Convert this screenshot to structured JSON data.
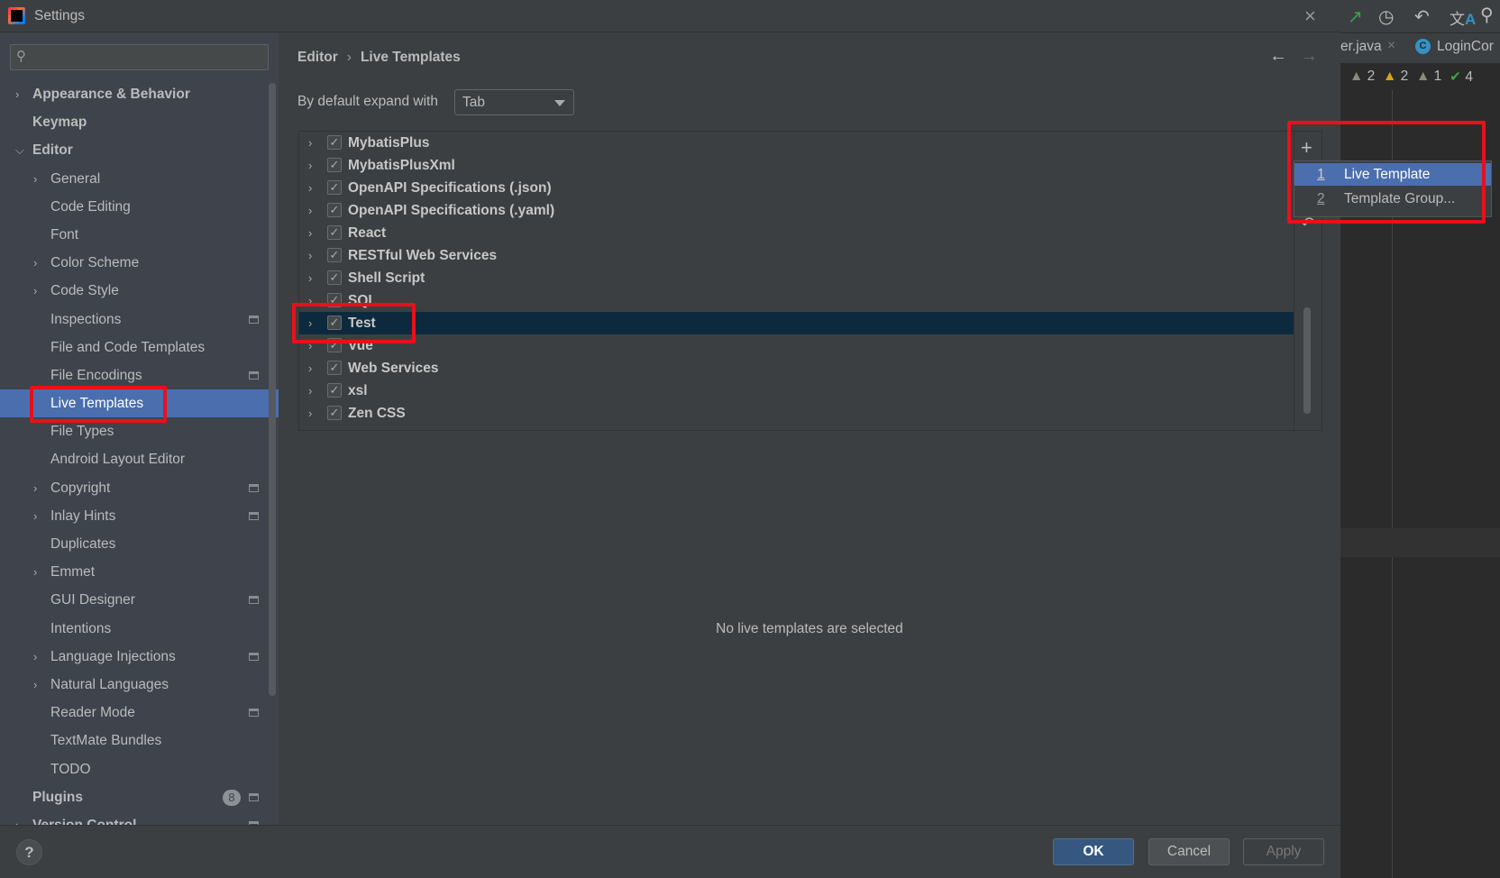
{
  "window": {
    "title": "Settings",
    "close": "×"
  },
  "search": {
    "placeholder": "",
    "icon": "search-icon"
  },
  "sidebar": {
    "items": [
      {
        "label": "Appearance & Behavior",
        "level": 0,
        "arrow": "right",
        "bold": true
      },
      {
        "label": "Keymap",
        "level": 0,
        "bold": true
      },
      {
        "label": "Editor",
        "level": 0,
        "arrow": "down",
        "bold": true
      },
      {
        "label": "General",
        "level": 1,
        "arrow": "right"
      },
      {
        "label": "Code Editing",
        "level": 1
      },
      {
        "label": "Font",
        "level": 1
      },
      {
        "label": "Color Scheme",
        "level": 1,
        "arrow": "right"
      },
      {
        "label": "Code Style",
        "level": 1,
        "arrow": "right"
      },
      {
        "label": "Inspections",
        "level": 1,
        "project": true
      },
      {
        "label": "File and Code Templates",
        "level": 1
      },
      {
        "label": "File Encodings",
        "level": 1,
        "project": true
      },
      {
        "label": "Live Templates",
        "level": 1,
        "selected": true
      },
      {
        "label": "File Types",
        "level": 1
      },
      {
        "label": "Android Layout Editor",
        "level": 1
      },
      {
        "label": "Copyright",
        "level": 1,
        "arrow": "right",
        "project": true
      },
      {
        "label": "Inlay Hints",
        "level": 1,
        "arrow": "right",
        "project": true
      },
      {
        "label": "Duplicates",
        "level": 1
      },
      {
        "label": "Emmet",
        "level": 1,
        "arrow": "right"
      },
      {
        "label": "GUI Designer",
        "level": 1,
        "project": true
      },
      {
        "label": "Intentions",
        "level": 1
      },
      {
        "label": "Language Injections",
        "level": 1,
        "arrow": "right",
        "project": true
      },
      {
        "label": "Natural Languages",
        "level": 1,
        "arrow": "right"
      },
      {
        "label": "Reader Mode",
        "level": 1,
        "project": true
      },
      {
        "label": "TextMate Bundles",
        "level": 1
      },
      {
        "label": "TODO",
        "level": 1
      },
      {
        "label": "Plugins",
        "level": 0,
        "bold": true,
        "badge": "8",
        "project": true
      },
      {
        "label": "Version Control",
        "level": 0,
        "arrow": "right",
        "bold": true,
        "project": true
      }
    ]
  },
  "main": {
    "breadcrumb": [
      "Editor",
      "Live Templates"
    ],
    "breadcrumb_sep": "›",
    "back": "←",
    "forward": "→",
    "expand_label": "By default expand with",
    "expand_value": "Tab",
    "groups": [
      {
        "name": "MybatisPlus",
        "checked": true
      },
      {
        "name": "MybatisPlusXml",
        "checked": true
      },
      {
        "name": "OpenAPI Specifications (.json)",
        "checked": true
      },
      {
        "name": "OpenAPI Specifications (.yaml)",
        "checked": true
      },
      {
        "name": "React",
        "checked": true
      },
      {
        "name": "RESTful Web Services",
        "checked": true
      },
      {
        "name": "Shell Script",
        "checked": true
      },
      {
        "name": "SQL",
        "checked": true
      },
      {
        "name": "Test",
        "checked": true,
        "selected": true
      },
      {
        "name": "Vue",
        "checked": true
      },
      {
        "name": "Web Services",
        "checked": true
      },
      {
        "name": "xsl",
        "checked": true
      },
      {
        "name": "Zen CSS",
        "checked": true
      }
    ],
    "toolbar": {
      "add": "+",
      "revert": "↶"
    },
    "empty_text": "No live templates are selected"
  },
  "popup": {
    "items": [
      {
        "num": "1",
        "label": "Live Template",
        "selected": true
      },
      {
        "num": "2",
        "label": "Template Group..."
      }
    ]
  },
  "footer": {
    "help": "?",
    "ok": "OK",
    "cancel": "Cancel",
    "apply": "Apply"
  },
  "editor": {
    "tabs": [
      "er.java",
      "LoginCor"
    ],
    "tab_close": "×",
    "class_icon": "C",
    "warnings": [
      {
        "icon": "warning-icon",
        "count": "2",
        "color": "#8c8c7a"
      },
      {
        "icon": "warning-icon",
        "count": "2",
        "color": "#d6a614"
      },
      {
        "icon": "weak-warning-icon",
        "count": "1",
        "color": "#8c8c7a"
      },
      {
        "icon": "check-icon",
        "count": "4",
        "color": "#3f9f49"
      }
    ]
  },
  "colors": {
    "accent": "#4b6eaf",
    "highlight_box": "#e8101c",
    "selection_row": "#0d293e"
  }
}
